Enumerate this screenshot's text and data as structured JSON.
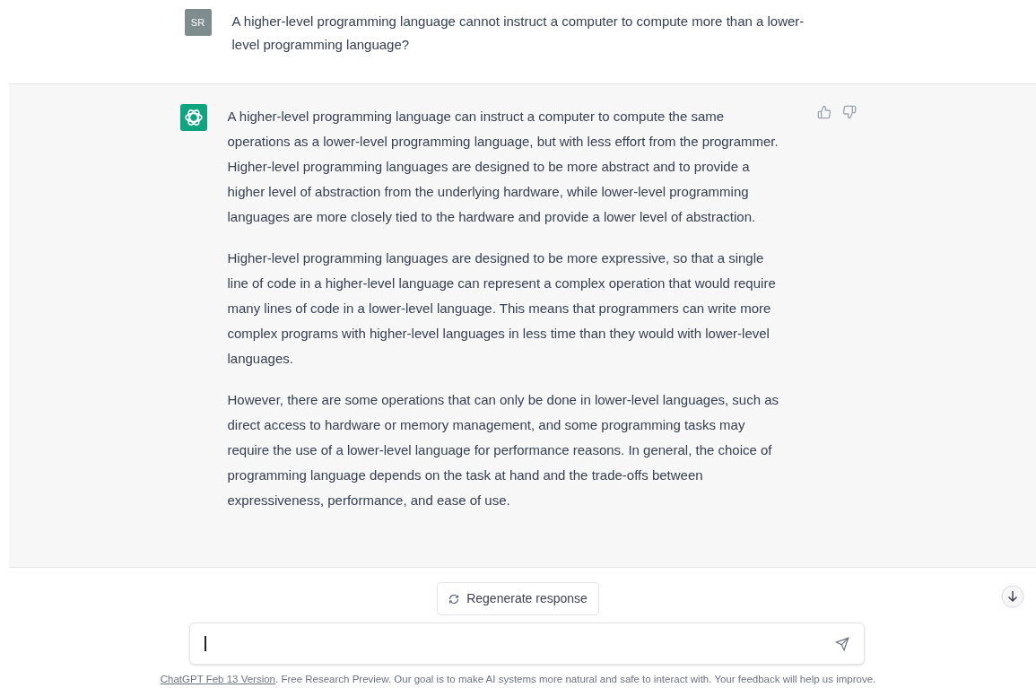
{
  "user_message": {
    "avatar": "SR",
    "text": "A higher-level programming language cannot instruct a computer to compute more than a lower-level programming language?"
  },
  "assistant_message": {
    "paragraphs": [
      "A higher-level programming language can instruct a computer to compute the same operations as a lower-level programming language, but with less effort from the programmer. Higher-level programming languages are designed to be more abstract and to provide a higher level of abstraction from the underlying hardware, while lower-level programming languages are more closely tied to the hardware and provide a lower level of abstraction.",
      "Higher-level programming languages are designed to be more expressive, so that a single line of code in a higher-level language can represent a complex operation that would require many lines of code in a lower-level language. This means that programmers can write more complex programs with higher-level languages in less time than they would with lower-level languages.",
      "However, there are some operations that can only be done in lower-level languages, such as direct access to hardware or memory management, and some programming tasks may require the use of a lower-level language for performance reasons. In general, the choice of programming language depends on the task at hand and the trade-offs between expressiveness, performance, and ease of use."
    ]
  },
  "regenerate_button": "Regenerate response",
  "footer": {
    "link": "ChatGPT Feb 13 Version",
    "text": ". Free Research Preview. Our goal is to make AI systems more natural and safe to interact with. Your feedback will help us improve."
  }
}
